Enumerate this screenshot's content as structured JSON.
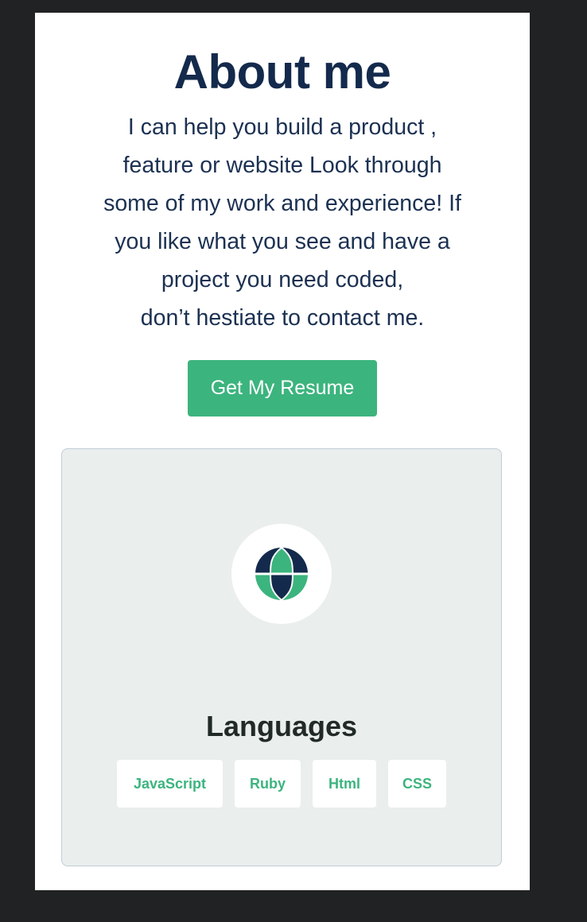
{
  "about": {
    "title": "About me",
    "intro_lines": [
      "I can help you build a product ,",
      "feature or website Look through",
      "some of my work and experience! If",
      "you like what you see and have a",
      "project you need coded,",
      "don’t hestiate to contact me."
    ],
    "resume_button": "Get My Resume"
  },
  "skills_card": {
    "icon": "globe-icon",
    "title": "Languages",
    "tags": [
      "JavaScript",
      "Ruby",
      "Html",
      "CSS"
    ]
  },
  "colors": {
    "background": "#212223",
    "page": "#ffffff",
    "heading": "#142a4c",
    "accent": "#3cb47e",
    "card": "#eaeeed",
    "icon_dark": "#142a4c"
  }
}
